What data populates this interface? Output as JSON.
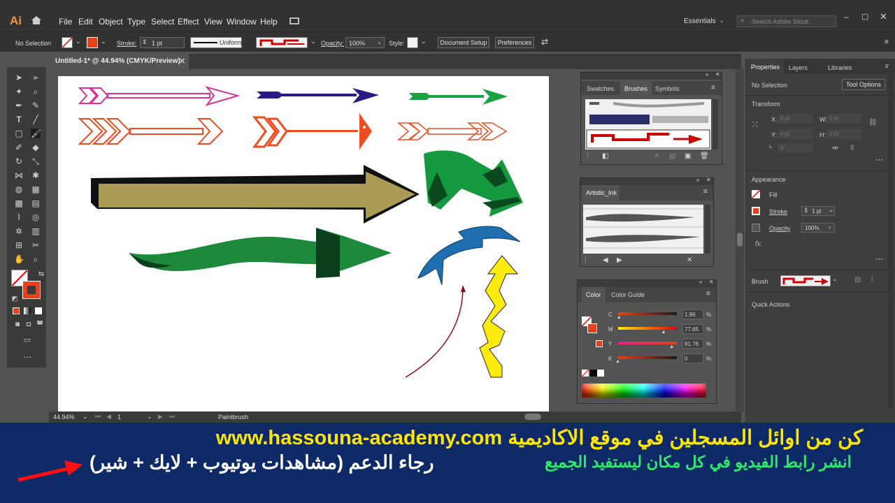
{
  "app": {
    "logo": "Ai",
    "workspace": "Essentials",
    "search_placeholder": "Search Adobe Stock"
  },
  "menu": [
    "File",
    "Edit",
    "Object",
    "Type",
    "Select",
    "Effect",
    "View",
    "Window",
    "Help"
  ],
  "control": {
    "selection": "No Selection",
    "stroke_label": "Stroke:",
    "stroke_value": "1 pt",
    "profile": "Uniform",
    "opacity_label": "Opacity:",
    "opacity_value": "100%",
    "style_label": "Style:",
    "doc_setup": "Document Setup",
    "preferences": "Preferences"
  },
  "document": {
    "tab": "Untitled-1* @ 44.94% (CMYK/Preview)"
  },
  "status": {
    "zoom": "44.94%",
    "page": "1",
    "tool": "Paintbrush"
  },
  "brushes_panel": {
    "tabs": [
      "Swatches",
      "Brushes",
      "Symbols"
    ],
    "active": "Brushes"
  },
  "artistic_panel": {
    "tab": "Artistic_Ink"
  },
  "color_panel": {
    "tabs": [
      "Color",
      "Color Guide"
    ],
    "channels": [
      {
        "name": "C",
        "value": "1.96",
        "unit": "%",
        "level": 0.02
      },
      {
        "name": "M",
        "value": "77.65",
        "unit": "%",
        "level": 0.78
      },
      {
        "name": "Y",
        "value": "91.76",
        "unit": "%",
        "level": 0.92
      },
      {
        "name": "K",
        "value": "0",
        "unit": "%",
        "level": 0.0
      }
    ]
  },
  "properties": {
    "tabs": [
      "Properties",
      "Layers",
      "Libraries"
    ],
    "selection": "No Selection",
    "tool_options": "Tool Options",
    "transform": "Transform",
    "x_label": "X:",
    "y_label": "Y:",
    "w_label": "W:",
    "h_label": "H:",
    "x_value": "0 pt",
    "y_value": "0 pt",
    "w_value": "0 pt",
    "h_value": "0 pt",
    "angle_value": "0°",
    "appearance": "Appearance",
    "fill": "Fill",
    "stroke": "Stroke",
    "stroke_value": "1 pt",
    "opacity": "Opacity",
    "opacity_value": "100%",
    "fx": "fx.",
    "brush": "Brush",
    "quick_actions": "Quick Actions"
  },
  "banner": {
    "line1": "كن من اوائل المسجلين في موقع الاكاديمية www.hassouna-academy.com",
    "line2_green": "انشر رابط الفيديو في كل مكان ليستفيد الجميع",
    "line2_white": "رجاء الدعم (مشاهدات يوتيوب + لايك + شير)"
  },
  "colors": {
    "accent": "#f47a1f",
    "fill_red": "#e8401c",
    "banner_bg": "#0d2a66",
    "banner_yellow": "#ffe600",
    "banner_green": "#2ee86c"
  }
}
